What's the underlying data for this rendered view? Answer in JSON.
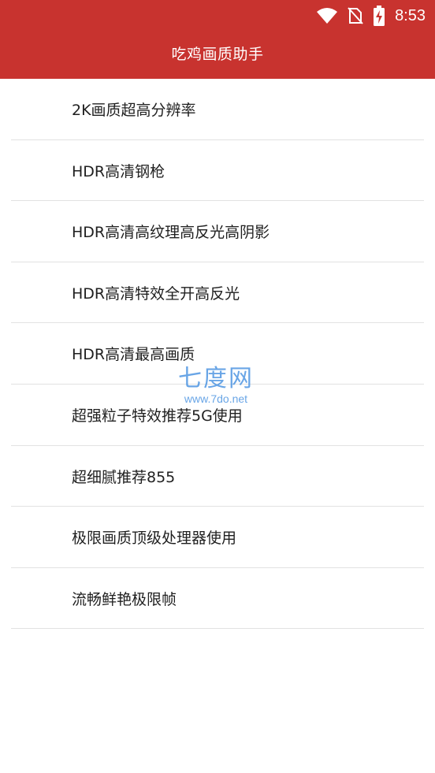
{
  "status_bar": {
    "time": "8:53",
    "icons": [
      "wifi-icon",
      "no-sim-icon",
      "battery-charging-icon"
    ]
  },
  "app_bar": {
    "title": "吃鸡画质助手",
    "color": "#c8332f"
  },
  "list": {
    "items": [
      {
        "label": "2K画质超高分辨率"
      },
      {
        "label": "HDR高清钢枪"
      },
      {
        "label": "HDR高清高纹理高反光高阴影"
      },
      {
        "label": "HDR高清特效全开高反光"
      },
      {
        "label": "HDR高清最高画质"
      },
      {
        "label": "超强粒子特效推荐5G使用"
      },
      {
        "label": "超细腻推荐855"
      },
      {
        "label": "极限画质顶级处理器使用"
      },
      {
        "label": "流畅鲜艳极限帧"
      }
    ]
  },
  "watermark": {
    "main": "七度网",
    "sub": "www.7do.net",
    "color": "#3f8de0"
  }
}
